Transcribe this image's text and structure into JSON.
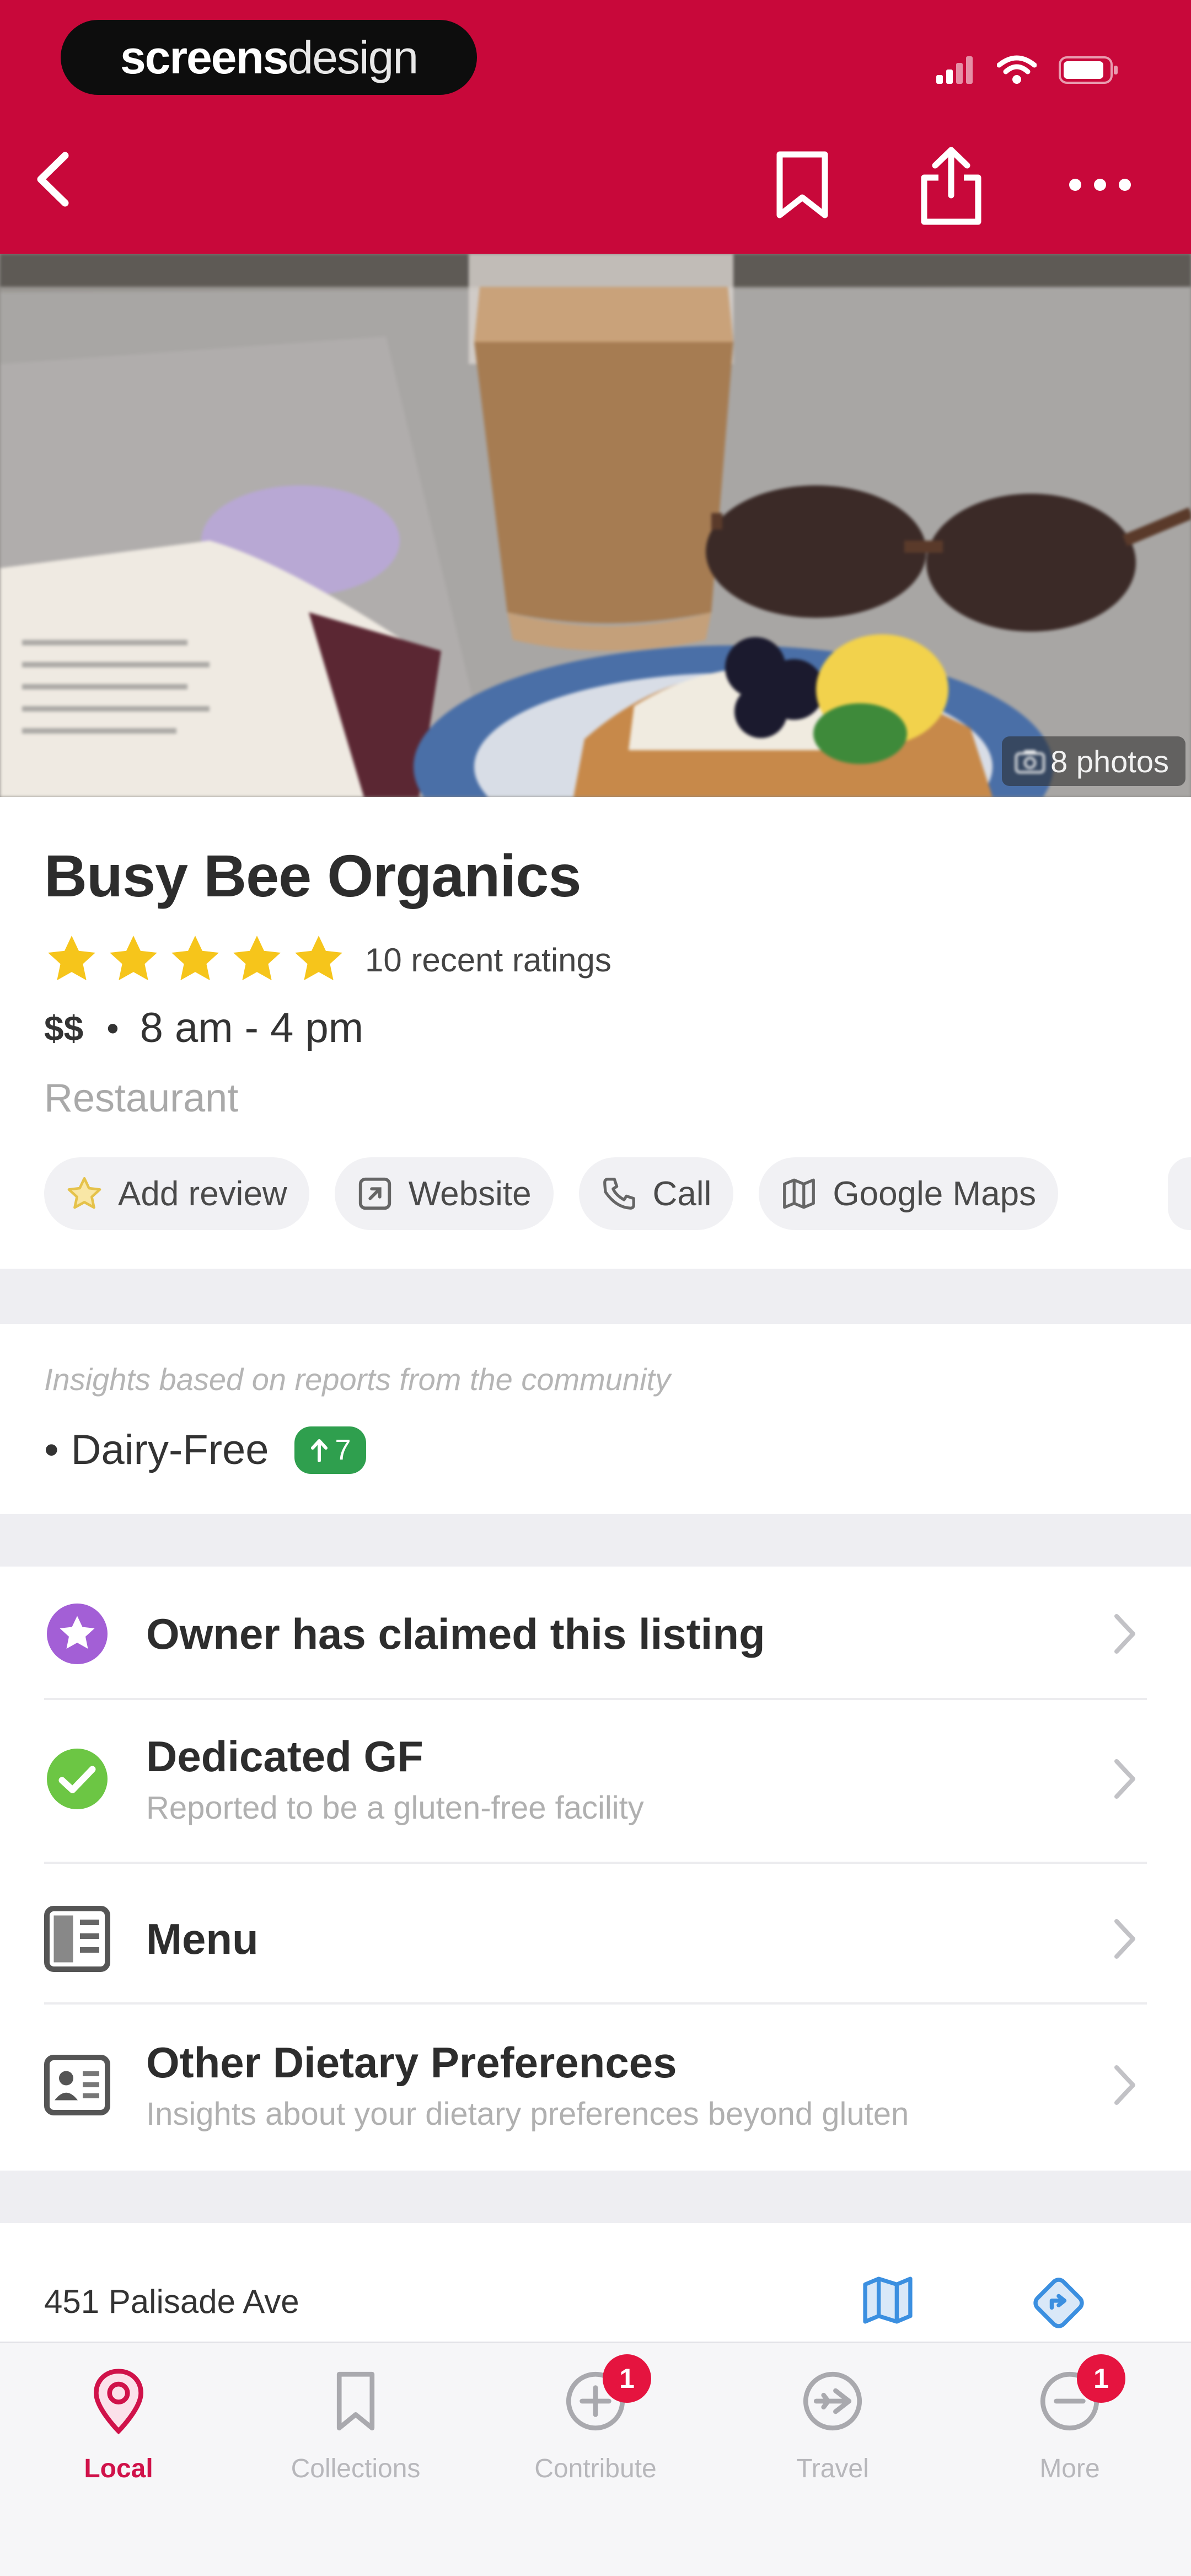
{
  "brand": {
    "part1": "screens",
    "part2": "design"
  },
  "colors": {
    "header": "#c8083a",
    "accent": "#d0124a",
    "star": "#f6c51b",
    "vote": "#2f9f4e",
    "badge": "#e5143f"
  },
  "nav": {
    "back_icon": "chevron-left-icon",
    "bookmark_icon": "bookmark-icon",
    "share_icon": "share-icon",
    "more_icon": "ellipsis-icon"
  },
  "hero": {
    "photos_label": "8 photos"
  },
  "place": {
    "name": "Busy Bee Organics",
    "rating": 5,
    "ratings_text": "10 recent ratings",
    "price": "$$",
    "hours": "8 am - 4 pm",
    "category": "Restaurant"
  },
  "actions": [
    {
      "label": "Add review",
      "icon": "star-outline-icon"
    },
    {
      "label": "Website",
      "icon": "external-link-icon"
    },
    {
      "label": "Call",
      "icon": "phone-icon"
    },
    {
      "label": "Google Maps",
      "icon": "map-icon"
    }
  ],
  "insights": {
    "caption": "Insights based on reports from the community",
    "items": [
      {
        "label": "Dairy-Free",
        "votes": "7"
      }
    ]
  },
  "list": [
    {
      "title": "Owner has claimed this listing",
      "subtitle": "",
      "icon": "verified-badge-icon"
    },
    {
      "title": "Dedicated GF",
      "subtitle": "Reported to be a gluten-free facility",
      "icon": "check-circle-icon"
    },
    {
      "title": "Menu",
      "subtitle": "",
      "icon": "menu-book-icon"
    },
    {
      "title": "Other Dietary Preferences",
      "subtitle": "Insights about your dietary preferences beyond gluten",
      "icon": "id-card-icon"
    }
  ],
  "address": {
    "line1": "451 Palisade Ave"
  },
  "tabs": [
    {
      "label": "Local",
      "icon": "location-pin-icon",
      "active": true,
      "badge": ""
    },
    {
      "label": "Collections",
      "icon": "bookmark-icon",
      "active": false,
      "badge": ""
    },
    {
      "label": "Contribute",
      "icon": "plus-circle-icon",
      "active": false,
      "badge": "1"
    },
    {
      "label": "Travel",
      "icon": "plane-circle-icon",
      "active": false,
      "badge": ""
    },
    {
      "label": "More",
      "icon": "minus-circle-icon",
      "active": false,
      "badge": "1"
    }
  ]
}
